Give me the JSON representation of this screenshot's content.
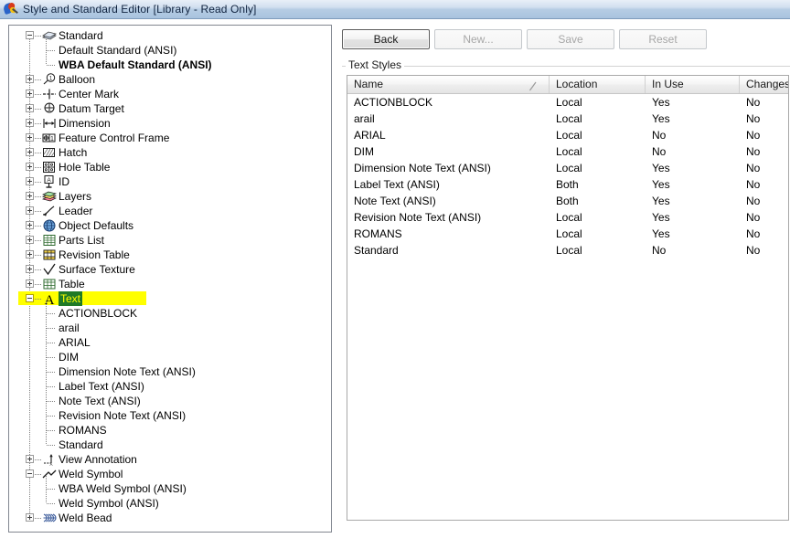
{
  "window": {
    "title": "Style and Standard Editor [Library - Read Only]",
    "icon": "style-editor-icon"
  },
  "toolbar": {
    "buttons": [
      {
        "label": "Back",
        "state": "enabled"
      },
      {
        "label": "New...",
        "state": "disabled"
      },
      {
        "label": "Save",
        "state": "disabled"
      },
      {
        "label": "Reset",
        "state": "disabled"
      }
    ]
  },
  "group": {
    "legend": "Text Styles"
  },
  "grid": {
    "columns": [
      "Name",
      "Location",
      "In Use",
      "Changes"
    ],
    "sort_indicator": "ascending-sort-icon",
    "rows": [
      {
        "name": "ACTIONBLOCK",
        "location": "Local",
        "in_use": "Yes",
        "changes": "No"
      },
      {
        "name": "arail",
        "location": "Local",
        "in_use": "Yes",
        "changes": "No"
      },
      {
        "name": "ARIAL",
        "location": "Local",
        "in_use": "No",
        "changes": "No"
      },
      {
        "name": "DIM",
        "location": "Local",
        "in_use": "No",
        "changes": "No"
      },
      {
        "name": "Dimension Note Text (ANSI)",
        "location": "Local",
        "in_use": "Yes",
        "changes": "No"
      },
      {
        "name": "Label Text (ANSI)",
        "location": "Both",
        "in_use": "Yes",
        "changes": "No"
      },
      {
        "name": "Note Text (ANSI)",
        "location": "Both",
        "in_use": "Yes",
        "changes": "No"
      },
      {
        "name": "Revision Note Text (ANSI)",
        "location": "Local",
        "in_use": "Yes",
        "changes": "No"
      },
      {
        "name": "ROMANS",
        "location": "Local",
        "in_use": "Yes",
        "changes": "No"
      },
      {
        "name": "Standard",
        "location": "Local",
        "in_use": "No",
        "changes": "No"
      }
    ]
  },
  "tree": {
    "nodes": [
      {
        "label": "Standard",
        "depth": 0,
        "expander": "minus",
        "icon": "standard-book-icon"
      },
      {
        "label": "Default Standard (ANSI)",
        "depth": 1,
        "expander": "none",
        "icon": "none"
      },
      {
        "label": "WBA Default Standard (ANSI)",
        "depth": 1,
        "expander": "none",
        "icon": "none",
        "bold": true
      },
      {
        "label": "Balloon",
        "depth": 0,
        "expander": "plus",
        "icon": "balloon-icon"
      },
      {
        "label": "Center Mark",
        "depth": 0,
        "expander": "plus",
        "icon": "center-mark-icon"
      },
      {
        "label": "Datum Target",
        "depth": 0,
        "expander": "plus",
        "icon": "datum-target-icon"
      },
      {
        "label": "Dimension",
        "depth": 0,
        "expander": "plus",
        "icon": "dimension-icon"
      },
      {
        "label": "Feature Control Frame",
        "depth": 0,
        "expander": "plus",
        "icon": "feature-control-frame-icon"
      },
      {
        "label": "Hatch",
        "depth": 0,
        "expander": "plus",
        "icon": "hatch-icon"
      },
      {
        "label": "Hole Table",
        "depth": 0,
        "expander": "plus",
        "icon": "hole-table-icon"
      },
      {
        "label": "ID",
        "depth": 0,
        "expander": "plus",
        "icon": "id-icon"
      },
      {
        "label": "Layers",
        "depth": 0,
        "expander": "plus",
        "icon": "layers-icon"
      },
      {
        "label": "Leader",
        "depth": 0,
        "expander": "plus",
        "icon": "leader-icon"
      },
      {
        "label": "Object Defaults",
        "depth": 0,
        "expander": "plus",
        "icon": "globe-icon"
      },
      {
        "label": "Parts List",
        "depth": 0,
        "expander": "plus",
        "icon": "parts-list-icon"
      },
      {
        "label": "Revision Table",
        "depth": 0,
        "expander": "plus",
        "icon": "revision-table-icon"
      },
      {
        "label": "Surface Texture",
        "depth": 0,
        "expander": "plus",
        "icon": "surface-texture-icon"
      },
      {
        "label": "Table",
        "depth": 0,
        "expander": "plus",
        "icon": "table-icon"
      },
      {
        "label": "Text",
        "depth": 0,
        "expander": "minus",
        "icon": "text-a-icon",
        "selected": true,
        "highlight": true
      },
      {
        "label": "ACTIONBLOCK",
        "depth": 1,
        "expander": "none",
        "icon": "none"
      },
      {
        "label": "arail",
        "depth": 1,
        "expander": "none",
        "icon": "none"
      },
      {
        "label": "ARIAL",
        "depth": 1,
        "expander": "none",
        "icon": "none"
      },
      {
        "label": "DIM",
        "depth": 1,
        "expander": "none",
        "icon": "none"
      },
      {
        "label": "Dimension Note Text (ANSI)",
        "depth": 1,
        "expander": "none",
        "icon": "none"
      },
      {
        "label": "Label Text (ANSI)",
        "depth": 1,
        "expander": "none",
        "icon": "none"
      },
      {
        "label": "Note Text (ANSI)",
        "depth": 1,
        "expander": "none",
        "icon": "none"
      },
      {
        "label": "Revision Note Text (ANSI)",
        "depth": 1,
        "expander": "none",
        "icon": "none"
      },
      {
        "label": "ROMANS",
        "depth": 1,
        "expander": "none",
        "icon": "none"
      },
      {
        "label": "Standard",
        "depth": 1,
        "expander": "none",
        "icon": "none"
      },
      {
        "label": "View Annotation",
        "depth": 0,
        "expander": "plus",
        "icon": "view-annotation-icon"
      },
      {
        "label": "Weld Symbol",
        "depth": 0,
        "expander": "minus",
        "icon": "weld-symbol-icon"
      },
      {
        "label": "WBA Weld Symbol (ANSI)",
        "depth": 1,
        "expander": "none",
        "icon": "none"
      },
      {
        "label": "Weld Symbol (ANSI)",
        "depth": 1,
        "expander": "none",
        "icon": "none"
      },
      {
        "label": "Weld Bead",
        "depth": 0,
        "expander": "plus",
        "icon": "weld-bead-icon"
      }
    ]
  },
  "colors": {
    "titlebar_top": "#e8eff8",
    "titlebar_bottom": "#a8c3de",
    "highlight_band": "#ffff00",
    "selection_bg": "#1f7a26",
    "selection_fg": "#ffff00",
    "grid_header_bg": "#ededed",
    "panel_border": "#828790"
  }
}
